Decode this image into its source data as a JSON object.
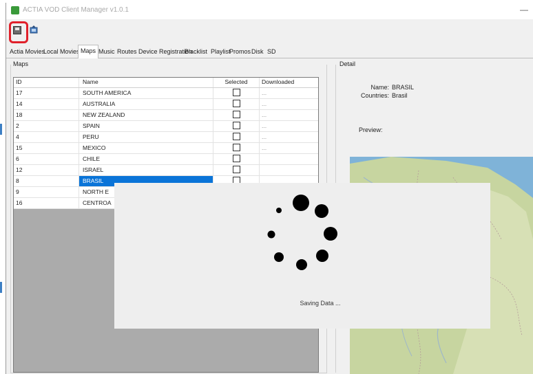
{
  "window": {
    "title": "ACTIA VOD Client Manager v1.0.1",
    "minimize_glyph": "—"
  },
  "toolbar": {
    "save_icon": "save-icon",
    "export_icon": "export-icon"
  },
  "tabs": [
    {
      "label": "Actia Movies"
    },
    {
      "label": "Local Movies"
    },
    {
      "label": "Maps"
    },
    {
      "label": "Music"
    },
    {
      "label": "Routes"
    },
    {
      "label": "Device Registration"
    },
    {
      "label": "Blacklist"
    },
    {
      "label": "Playlist"
    },
    {
      "label": "Promos"
    },
    {
      "label": "Disk"
    },
    {
      "label": "SD"
    }
  ],
  "active_tab": "Maps",
  "maps": {
    "group_title": "Maps",
    "columns": {
      "id": "ID",
      "name": "Name",
      "selected": "Selected",
      "downloaded": "Downloaded"
    },
    "rows": [
      {
        "id": "17",
        "name": "SOUTH AMERICA",
        "selected": false,
        "downloaded": "..."
      },
      {
        "id": "14",
        "name": "AUSTRALIA",
        "selected": false,
        "downloaded": "..."
      },
      {
        "id": "18",
        "name": "NEW ZEALAND",
        "selected": false,
        "downloaded": "..."
      },
      {
        "id": "2",
        "name": "SPAIN",
        "selected": false,
        "downloaded": "..."
      },
      {
        "id": "4",
        "name": "PERU",
        "selected": false,
        "downloaded": "..."
      },
      {
        "id": "15",
        "name": "MEXICO",
        "selected": false,
        "downloaded": "..."
      },
      {
        "id": "6",
        "name": "CHILE",
        "selected": false,
        "downloaded": ""
      },
      {
        "id": "12",
        "name": "ISRAEL",
        "selected": false,
        "downloaded": ""
      },
      {
        "id": "8",
        "name": "BRASIL",
        "selected": false,
        "downloaded": ""
      },
      {
        "id": "9",
        "name": "NORTH E",
        "selected": false,
        "downloaded": ""
      },
      {
        "id": "16",
        "name": "CENTROA",
        "selected": false,
        "downloaded": ""
      }
    ],
    "selected_row_id": "8"
  },
  "detail": {
    "group_title": "Detail",
    "name_label": "Name:",
    "name_value": "BRASIL",
    "countries_label": "Countries:",
    "countries_value": "Brasil",
    "preview_label": "Preview:"
  },
  "loading": {
    "message": "Saving Data ..."
  },
  "colors": {
    "selection": "#0a74d8",
    "highlight": "#e0202a",
    "app_icon": "#3a9a3a",
    "map_sea": "#7fb3d8",
    "map_land": "#c7d5a0"
  }
}
